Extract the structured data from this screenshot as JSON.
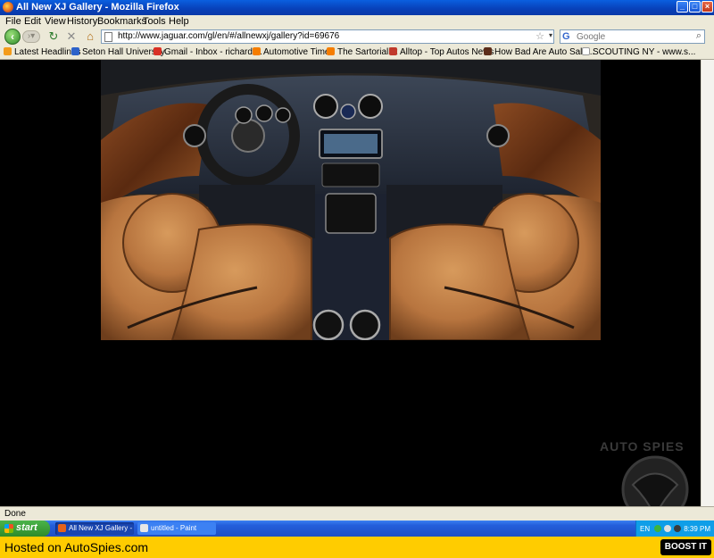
{
  "window": {
    "title": "All New XJ Gallery - Mozilla Firefox",
    "controls": [
      "minimize",
      "maximize",
      "close"
    ]
  },
  "menu": {
    "file": "File",
    "edit": "Edit",
    "view": "View",
    "history": "History",
    "bookmarks": "Bookmarks",
    "tools": "Tools",
    "help": "Help"
  },
  "nav": {
    "url": "http://www.jaguar.com/gl/en/#/allnewxj/gallery?id=69676",
    "search_engine": "G",
    "search_placeholder": "Google",
    "icons": [
      "back-icon",
      "forward-icon",
      "reload-icon",
      "stop-icon",
      "home-icon",
      "star-icon",
      "search-icon"
    ]
  },
  "bookmarks": [
    {
      "label": "Latest Headlines",
      "color": "#f39c1b"
    },
    {
      "label": "Seton Hall University",
      "color": "#2d62c9"
    },
    {
      "label": "Gmail - Inbox - richard....",
      "color": "#d93025"
    },
    {
      "label": "Automotive Times",
      "color": "#f57d00"
    },
    {
      "label": "The Sartorialist",
      "color": "#f57d00"
    },
    {
      "label": "Alltop - Top Autos News",
      "color": "#c0392b"
    },
    {
      "label": "How Bad Are Auto Sale...",
      "color": "#5b2c1a"
    },
    {
      "label": "SCOUTING NY - www.s...",
      "color": "#ffffff"
    }
  ],
  "status": {
    "text": "Done"
  },
  "taskbar": {
    "start_label": "start",
    "tasks": [
      {
        "label": "All New XJ Gallery - M...",
        "active": true
      },
      {
        "label": "untitled - Paint",
        "active": false
      }
    ],
    "tray": {
      "lang": "EN",
      "time": "8:39 PM"
    }
  },
  "watermark": {
    "text": "AUTO SPIES"
  },
  "banner": {
    "hosted_text": "Hosted on AutoSpies.com",
    "boost_label": "BOOST IT"
  },
  "colors": {
    "accent_blue": "#245edb",
    "banner_yellow": "#ffcc00",
    "leather_tan": "#b8753f"
  }
}
